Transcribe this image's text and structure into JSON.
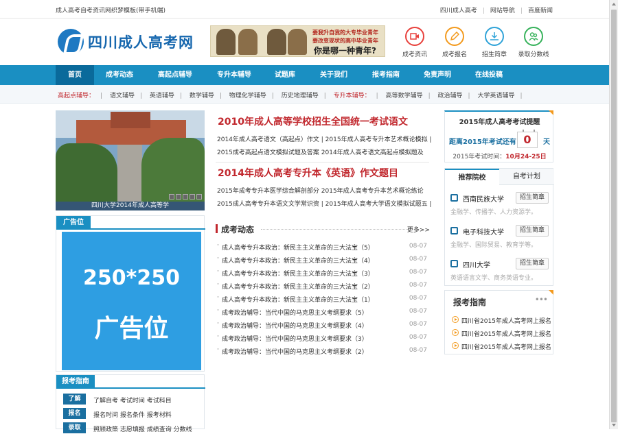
{
  "topbar": {
    "left_text": "成人高考自考资讯网织梦模板(带手机端)",
    "links": [
      "四川成人高考",
      "网站导航",
      "百度新闻"
    ]
  },
  "header": {
    "logo_text": "四川成人高考网",
    "banner": {
      "line1": "要我升自我的大专毕业青年",
      "line2": "要改变现状的高中毕业青年",
      "line3": "你是哪一种青年?"
    },
    "icons": [
      {
        "label": "成考资讯",
        "icon": "video-camera-icon",
        "color": "#e8413c"
      },
      {
        "label": "成考报名",
        "icon": "edit-pencil-icon",
        "color": "#f39a1e"
      },
      {
        "label": "招生简章",
        "icon": "download-icon",
        "color": "#2fa3d8"
      },
      {
        "label": "录取分数线",
        "icon": "users-icon",
        "color": "#37b25b"
      }
    ]
  },
  "nav": {
    "items": [
      "首页",
      "成考动态",
      "高起点辅导",
      "专升本辅导",
      "试题库",
      "关于我们",
      "报考指南",
      "免责声明",
      "在线投稿"
    ],
    "active_index": 0
  },
  "subnav": {
    "group1_label": "高起点辅导：",
    "group1": [
      "语文辅导",
      "英语辅导",
      "数学辅导",
      "物理化学辅导",
      "历史地理辅导"
    ],
    "group2_label": "专升本辅导：",
    "group2": [
      "高等数学辅导",
      "政治辅导",
      "大学英语辅导"
    ]
  },
  "slideshow": {
    "caption": "四川大学2014年成人高等学",
    "dots": [
      "1",
      "2",
      "3",
      "4",
      "5"
    ]
  },
  "ad": {
    "title": "广告位",
    "size_text": "250*250",
    "label": "广告位"
  },
  "guide": {
    "title": "报考指南",
    "rows": [
      {
        "tag": "了解",
        "links": "了解自考  考试时间  考试科目"
      },
      {
        "tag": "报名",
        "links": "报名时间  报名条件  报考材料"
      },
      {
        "tag": "录取",
        "links": "照顾政策  志愿填报  成绩查询  分数线"
      }
    ]
  },
  "headlines": [
    {
      "title": "2010年成人高等学校招生全国统一考试语文",
      "lines": [
        "2014年成人高考语文（高起点）作文 | 2015年成人高考专升本艺术概论模拟 |",
        "2015成考高起点语文模拟试题及答案  2014年成人高考语文高起点模拟题及"
      ]
    },
    {
      "title": "2014年成人高考专升本《英语》作文题目",
      "lines": [
        "2015年成考专升本医学综合解剖部分  2015年成人高考专升本艺术概论练论",
        "2015成人高考专升本语文文学常识资 | 2015年成人高考大学语文模拟试题五 |"
      ]
    }
  ],
  "news": {
    "title": "成考动态",
    "more": "更多>>",
    "items": [
      {
        "title": "成人高考专升本政治：新民主主义革命的三大法宝（5）",
        "date": "08-07"
      },
      {
        "title": "成人高考专升本政治：新民主主义革命的三大法宝（4）",
        "date": "08-07"
      },
      {
        "title": "成人高考专升本政治：新民主主义革命的三大法宝（3）",
        "date": "08-07"
      },
      {
        "title": "成人高考专升本政治：新民主主义革命的三大法宝（2）",
        "date": "08-07"
      },
      {
        "title": "成人高考专升本政治：新民主主义革命的三大法宝（1）",
        "date": "08-07"
      },
      {
        "title": "成考政治辅导：当代中国的马克思主义考纲要求（5）",
        "date": "08-07"
      },
      {
        "title": "成考政治辅导：当代中国的马克思主义考纲要求（4）",
        "date": "08-07"
      },
      {
        "title": "成考政治辅导：当代中国的马克思主义考纲要求（3）",
        "date": "08-07"
      },
      {
        "title": "成考政治辅导：当代中国的马克思主义考纲要求（2）",
        "date": "08-07"
      }
    ]
  },
  "exam": {
    "title": "2015年成人高考考试提醒",
    "countdown_prefix": "距离2015年考试还有",
    "days": "0",
    "unit": "天",
    "date_prefix": "2015年考试时间：",
    "date": "10月24-25日"
  },
  "school": {
    "tabs": [
      "推荐院校",
      "自考计划"
    ],
    "active_tab": 0,
    "items": [
      {
        "name": "西南民族大学",
        "button": "招生简章",
        "desc": "金融学、传播学、人力资源学。",
        "icon": "building-icon"
      },
      {
        "name": "电子科技大学",
        "button": "招生简章",
        "desc": "金融学、国际贸易、教育学等。",
        "icon": "edit-icon"
      },
      {
        "name": "四川大学",
        "button": "招生简章",
        "desc": "英语语言文学、商务英语专业。",
        "icon": "calendar-icon"
      }
    ]
  },
  "signup": {
    "title": "报考指南",
    "items": [
      "四川省2015年成人高考网上报名",
      "四川省2015年成人高考网上报名",
      "四川省2015年成人高考网上报名"
    ]
  }
}
